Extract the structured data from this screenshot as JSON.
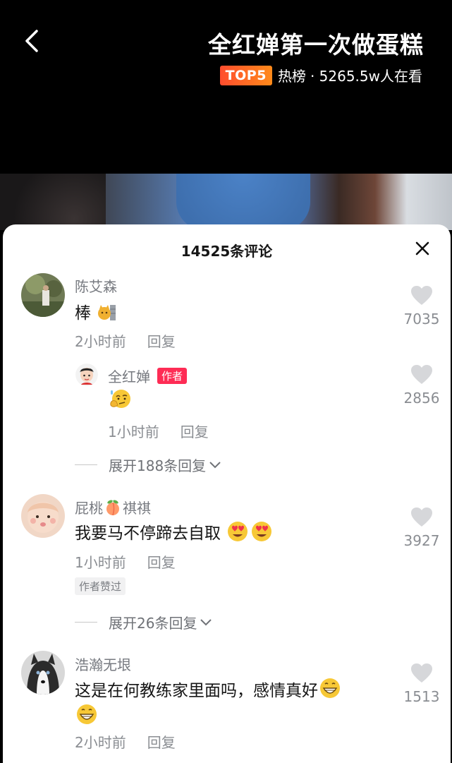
{
  "header": {
    "title": "全红婵第一次做蛋糕",
    "badge": "TOP5",
    "hot_label": "热榜",
    "views": "· 5265.5w人在看"
  },
  "panel": {
    "comment_count": "14525条评论"
  },
  "comments": [
    {
      "user": "陈艾森",
      "text": "棒",
      "time": "2小时前",
      "reply_label": "回复",
      "likes": "7035"
    },
    {
      "user": "全红婵",
      "author_tag": "作者",
      "time": "1小时前",
      "reply_label": "回复",
      "likes": "2856"
    },
    {
      "expand": "展开188条回复"
    },
    {
      "user_part1": "屁桃",
      "user_part2": "祺祺",
      "text": "我要马不停蹄去自取",
      "time": "1小时前",
      "reply_label": "回复",
      "liked_tag": "作者赞过",
      "likes": "3927"
    },
    {
      "expand": "展开26条回复"
    },
    {
      "user": "浩瀚无垠",
      "text": "这是在何教练家里面吗，感情真好",
      "time": "2小时前",
      "reply_label": "回复",
      "likes": "1513"
    }
  ]
}
